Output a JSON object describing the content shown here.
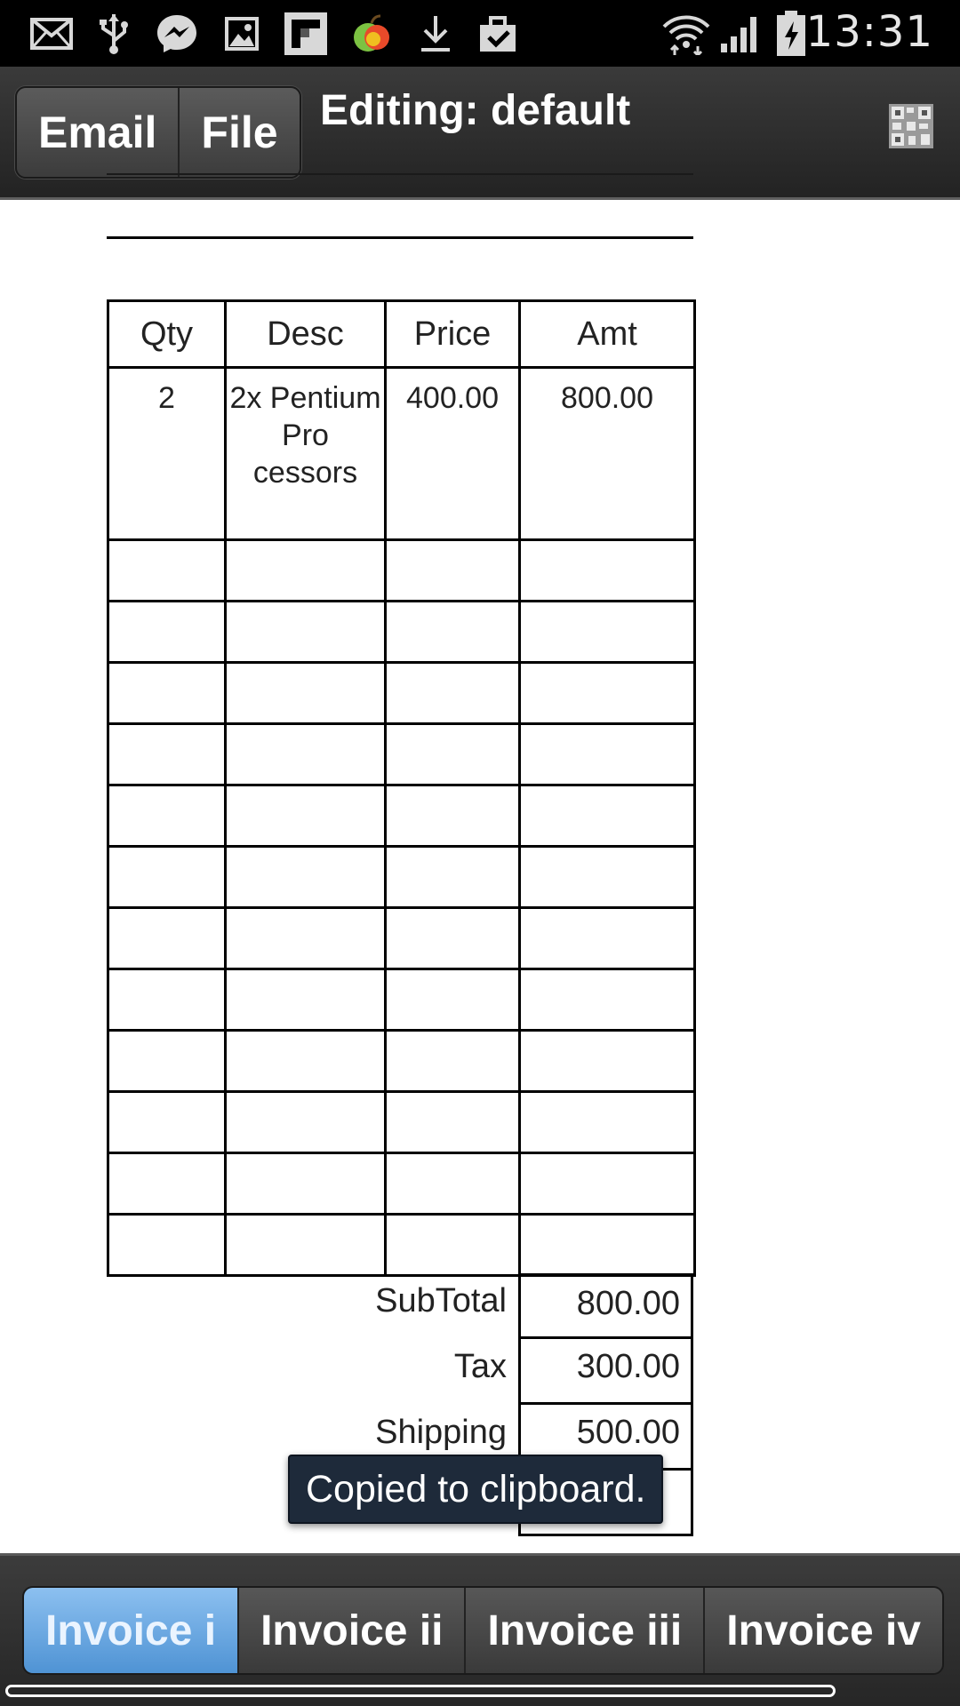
{
  "status_bar": {
    "time": "13:31",
    "icons": [
      "email-icon",
      "usb-icon",
      "messenger-icon",
      "image-icon",
      "flipboard-icon",
      "fruit-app-icon",
      "download-icon",
      "clipboard-check-icon",
      "wifi-icon",
      "signal-icon",
      "battery-charging-icon"
    ]
  },
  "header": {
    "email_label": "Email",
    "file_label": "File",
    "title": "Editing: default",
    "qr_icon": "qr-code-icon"
  },
  "invoice": {
    "columns": [
      "Qty",
      "Desc",
      "Price",
      "Amt"
    ],
    "items": [
      {
        "qty": "2",
        "desc": "2x Pentium Pro cessors",
        "price": "400.00",
        "amt": "800.00"
      }
    ],
    "empty_rows": 12,
    "totals": [
      {
        "label": "SubTotal",
        "value": "800.00"
      },
      {
        "label": "Tax",
        "value": "300.00"
      },
      {
        "label": "Shipping",
        "value": "500.00"
      },
      {
        "label": "",
        "value": ""
      }
    ]
  },
  "toast": {
    "message": "Copied to clipboard."
  },
  "footer": {
    "tabs": [
      {
        "label": "Invoice i",
        "active": true
      },
      {
        "label": "Invoice ii",
        "active": false
      },
      {
        "label": "Invoice iii",
        "active": false
      },
      {
        "label": "Invoice iv",
        "active": false
      }
    ]
  },
  "colors": {
    "status_bar_bg": "#000000",
    "toolbar_bg": "#2e2e2e",
    "active_tab": "#5a9ad8",
    "toast_bg": "#1e2a3a"
  }
}
